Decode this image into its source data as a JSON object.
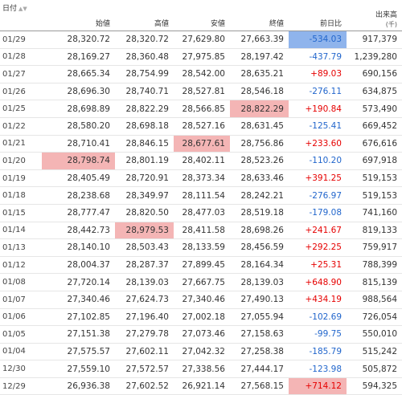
{
  "headers": {
    "date": "日付",
    "open": "始値",
    "high": "高値",
    "low": "安値",
    "close": "終値",
    "change": "前日比",
    "volume": "出来高",
    "volume_unit": "(千)",
    "sort_glyph": "▲▼"
  },
  "rows": [
    {
      "date": "01/29",
      "open": "28,320.72",
      "high": "28,320.72",
      "low": "27,629.80",
      "close": "27,663.39",
      "change": "-534.03",
      "volume": "917,379"
    },
    {
      "date": "01/28",
      "open": "28,169.27",
      "high": "28,360.48",
      "low": "27,975.85",
      "close": "28,197.42",
      "change": "-437.79",
      "volume": "1,239,280"
    },
    {
      "date": "01/27",
      "open": "28,665.34",
      "high": "28,754.99",
      "low": "28,542.00",
      "close": "28,635.21",
      "change": "+89.03",
      "volume": "690,156"
    },
    {
      "date": "01/26",
      "open": "28,696.30",
      "high": "28,740.71",
      "low": "28,527.81",
      "close": "28,546.18",
      "change": "-276.11",
      "volume": "634,875"
    },
    {
      "date": "01/25",
      "open": "28,698.89",
      "high": "28,822.29",
      "low": "28,566.85",
      "close": "28,822.29",
      "change": "+190.84",
      "volume": "573,490"
    },
    {
      "date": "01/22",
      "open": "28,580.20",
      "high": "28,698.18",
      "low": "28,527.16",
      "close": "28,631.45",
      "change": "-125.41",
      "volume": "669,452"
    },
    {
      "date": "01/21",
      "open": "28,710.41",
      "high": "28,846.15",
      "low": "28,677.61",
      "close": "28,756.86",
      "change": "+233.60",
      "volume": "676,616"
    },
    {
      "date": "01/20",
      "open": "28,798.74",
      "high": "28,801.19",
      "low": "28,402.11",
      "close": "28,523.26",
      "change": "-110.20",
      "volume": "697,918"
    },
    {
      "date": "01/19",
      "open": "28,405.49",
      "high": "28,720.91",
      "low": "28,373.34",
      "close": "28,633.46",
      "change": "+391.25",
      "volume": "519,153"
    },
    {
      "date": "01/18",
      "open": "28,238.68",
      "high": "28,349.97",
      "low": "28,111.54",
      "close": "28,242.21",
      "change": "-276.97",
      "volume": "519,153"
    },
    {
      "date": "01/15",
      "open": "28,777.47",
      "high": "28,820.50",
      "low": "28,477.03",
      "close": "28,519.18",
      "change": "-179.08",
      "volume": "741,160"
    },
    {
      "date": "01/14",
      "open": "28,442.73",
      "high": "28,979.53",
      "low": "28,411.58",
      "close": "28,698.26",
      "change": "+241.67",
      "volume": "819,133"
    },
    {
      "date": "01/13",
      "open": "28,140.10",
      "high": "28,503.43",
      "low": "28,133.59",
      "close": "28,456.59",
      "change": "+292.25",
      "volume": "759,917"
    },
    {
      "date": "01/12",
      "open": "28,004.37",
      "high": "28,287.37",
      "low": "27,899.45",
      "close": "28,164.34",
      "change": "+25.31",
      "volume": "788,399"
    },
    {
      "date": "01/08",
      "open": "27,720.14",
      "high": "28,139.03",
      "low": "27,667.75",
      "close": "28,139.03",
      "change": "+648.90",
      "volume": "815,139"
    },
    {
      "date": "01/07",
      "open": "27,340.46",
      "high": "27,624.73",
      "low": "27,340.46",
      "close": "27,490.13",
      "change": "+434.19",
      "volume": "988,564"
    },
    {
      "date": "01/06",
      "open": "27,102.85",
      "high": "27,196.40",
      "low": "27,002.18",
      "close": "27,055.94",
      "change": "-102.69",
      "volume": "726,054"
    },
    {
      "date": "01/05",
      "open": "27,151.38",
      "high": "27,279.78",
      "low": "27,073.46",
      "close": "27,158.63",
      "change": "-99.75",
      "volume": "550,010"
    },
    {
      "date": "01/04",
      "open": "27,575.57",
      "high": "27,602.11",
      "low": "27,042.32",
      "close": "27,258.38",
      "change": "-185.79",
      "volume": "515,242"
    },
    {
      "date": "12/30",
      "open": "27,559.10",
      "high": "27,572.57",
      "low": "27,338.56",
      "close": "27,444.17",
      "change": "-123.98",
      "volume": "505,872"
    },
    {
      "date": "12/29",
      "open": "26,936.38",
      "high": "27,602.52",
      "low": "26,921.14",
      "close": "27,568.15",
      "change": "+714.12",
      "volume": "594,325"
    }
  ],
  "highlights": [
    {
      "row": 0,
      "col": "change",
      "color": "#8fb4ec"
    },
    {
      "row": 4,
      "col": "close",
      "color": "#f4b5b5"
    },
    {
      "row": 6,
      "col": "low",
      "color": "#f4b5b5"
    },
    {
      "row": 7,
      "col": "open",
      "color": "#f4b5b5"
    },
    {
      "row": 11,
      "col": "high",
      "color": "#f4b5b5"
    },
    {
      "row": 20,
      "col": "change",
      "color": "#f4b5b5"
    }
  ],
  "colors": {
    "positive": "#e60000",
    "negative": "#2266cc",
    "highlight_red": "#f4b5b5",
    "highlight_blue": "#8fb4ec"
  }
}
